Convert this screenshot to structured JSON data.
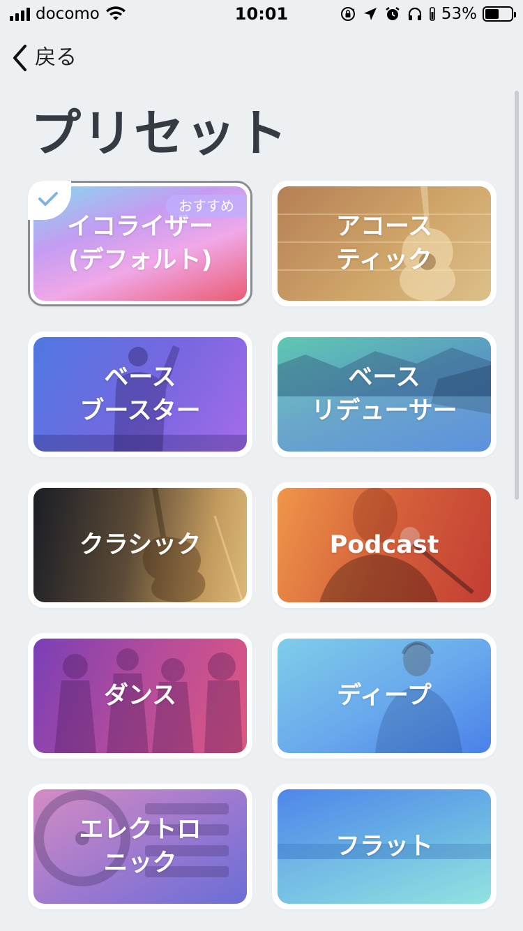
{
  "status_bar": {
    "carrier": "docomo",
    "time": "10:01",
    "battery_percent": "53%",
    "battery_level": 0.53,
    "icons": [
      "signal-icon",
      "wifi-icon",
      "orientation-lock-icon",
      "location-icon",
      "alarm-icon",
      "headphones-icon",
      "battery-icon"
    ]
  },
  "nav": {
    "back_label": "戻る"
  },
  "page": {
    "title": "プリセット"
  },
  "presets": [
    {
      "id": "default",
      "label": "イコライザー\n(デフォルト)",
      "selected": true,
      "badge": "おすすめ"
    },
    {
      "id": "acoustic",
      "label": "アコース\nティック"
    },
    {
      "id": "bass-booster",
      "label": "ベース\nブースター"
    },
    {
      "id": "bass-reducer",
      "label": "ベース\nリデューサー"
    },
    {
      "id": "classic",
      "label": "クラシック"
    },
    {
      "id": "podcast",
      "label": "Podcast"
    },
    {
      "id": "dance",
      "label": "ダンス"
    },
    {
      "id": "deep",
      "label": "ディープ"
    },
    {
      "id": "electronic",
      "label": "エレクトロ\nニック"
    },
    {
      "id": "flat",
      "label": "フラット"
    }
  ],
  "colors": {
    "background": "#edf0f3",
    "title": "#363a42",
    "check": "#7fb3e4"
  }
}
